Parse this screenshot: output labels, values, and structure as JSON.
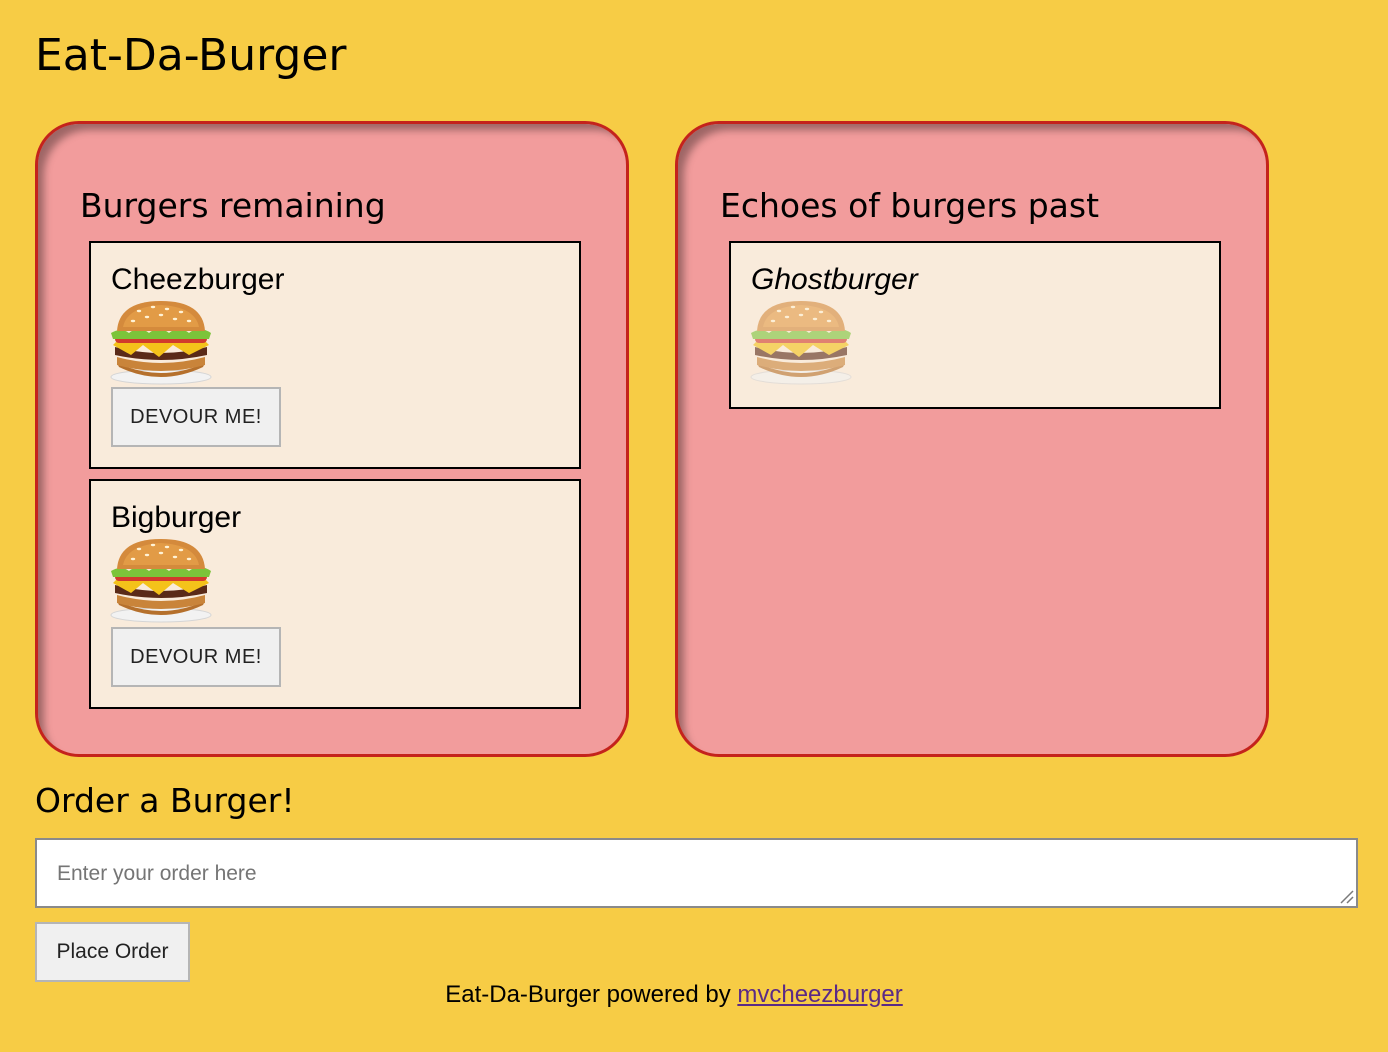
{
  "app": {
    "title": "Eat-Da-Burger"
  },
  "remaining": {
    "heading": "Burgers remaining",
    "burgers": [
      {
        "name": "Cheezburger",
        "button_label": "DEVOUR ME!",
        "icon": "burger-icon"
      },
      {
        "name": "Bigburger",
        "button_label": "DEVOUR ME!",
        "icon": "burger-icon"
      }
    ]
  },
  "devoured": {
    "heading": "Echoes of burgers past",
    "burgers": [
      {
        "name": "Ghostburger",
        "icon": "burger-icon"
      }
    ]
  },
  "order": {
    "heading": "Order a Burger!",
    "input_value": "",
    "placeholder": "Enter your order here",
    "button_label": "Place Order"
  },
  "footer": {
    "text": "Eat-Da-Burger powered by ",
    "link_text": "mvcheezburger"
  },
  "colors": {
    "background": "#f7cc45",
    "panel_fill": "#f29c9c",
    "panel_border": "#c4231c",
    "card_fill": "#f9ebdb",
    "link": "#5b2a86"
  }
}
